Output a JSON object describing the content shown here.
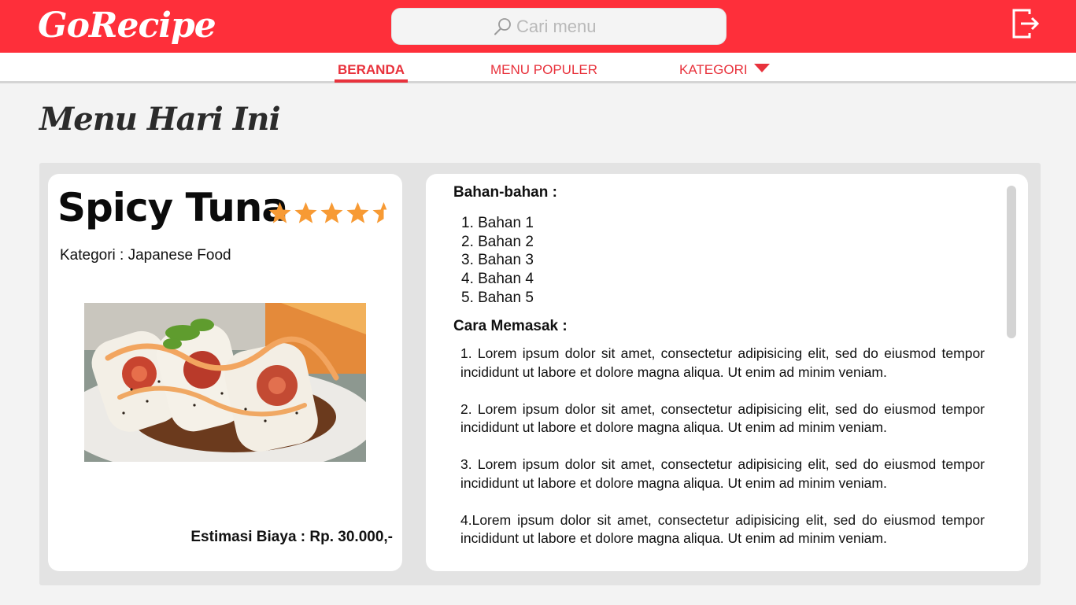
{
  "app": {
    "logo_text": "GoRecipe"
  },
  "header": {
    "search_placeholder": "Cari menu",
    "search_icon": "search-icon",
    "logout_icon": "logout-icon"
  },
  "nav": {
    "items": [
      {
        "label": "BERANDA",
        "active": true
      },
      {
        "label": "MENU POPULER",
        "active": false
      },
      {
        "label": "KATEGORI",
        "active": false,
        "dropdown": true
      }
    ]
  },
  "page": {
    "title": "Menu Hari Ini"
  },
  "recipe": {
    "name": "Spicy Tuna",
    "rating": 4.5,
    "rating_max": 5,
    "category_line": "Kategori : Japanese Food",
    "photo_description": "",
    "cost_line": "Estimasi Biaya : Rp. 30.000,-",
    "ingredients_title": "Bahan-bahan :",
    "ingredients": [
      "1. Bahan 1",
      "2. Bahan 2",
      "3. Bahan 3",
      "4. Bahan 4",
      "5. Bahan 5"
    ],
    "steps_title": "Cara Memasak :",
    "steps": [
      "1. Lorem ipsum dolor sit amet, consectetur adipisicing elit, sed do eiusmod tempor incididunt ut labore et dolore magna aliqua. Ut enim ad minim veniam.",
      "2. Lorem ipsum dolor sit amet, consectetur adipisicing elit, sed do eiusmod tempor incididunt ut labore et dolore magna aliqua. Ut enim ad minim veniam.",
      "3. Lorem ipsum dolor sit amet, consectetur adipisicing elit, sed do eiusmod tempor incididunt ut labore et dolore magna aliqua. Ut enim ad minim veniam.",
      "4.Lorem ipsum dolor sit amet, consectetur adipisicing elit, sed do eiusmod tempor incididunt ut labore et dolore magna aliqua. Ut enim ad minim veniam."
    ]
  },
  "colors": {
    "brand_red": "#fe2f3a",
    "nav_text": "#e8323c",
    "star": "#f79a34",
    "background": "#f3f3f3"
  }
}
